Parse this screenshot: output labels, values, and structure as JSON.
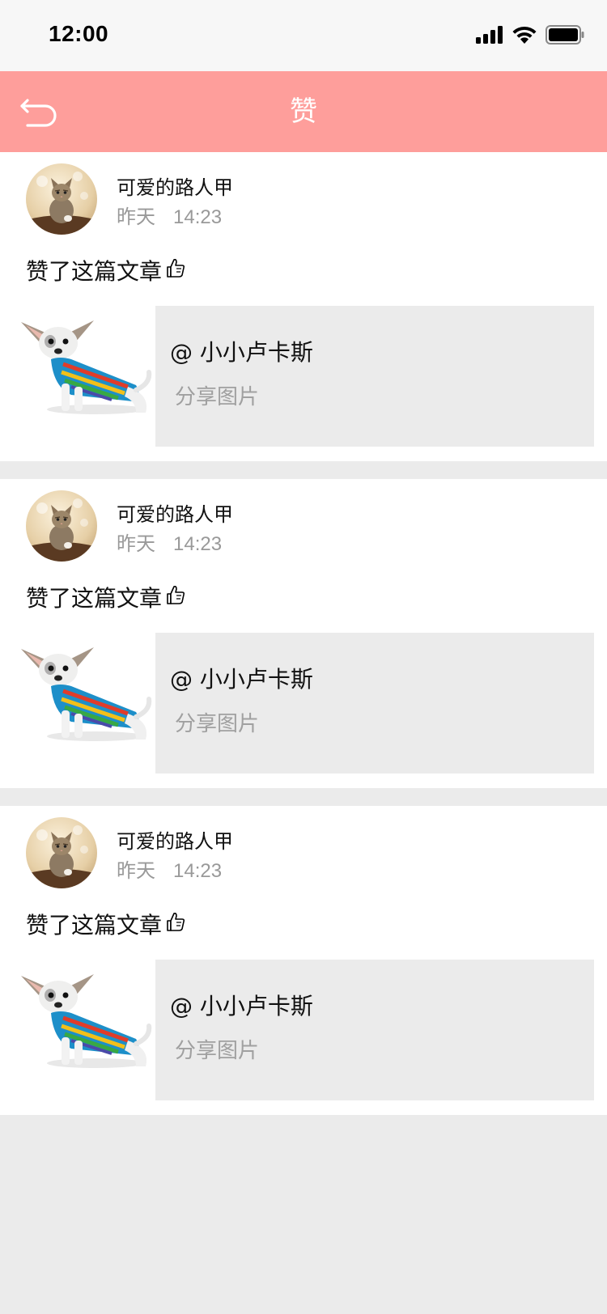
{
  "status_bar": {
    "time": "12:00",
    "icons": [
      "signal-icon",
      "wifi-icon",
      "battery-icon"
    ]
  },
  "nav": {
    "title": "赞",
    "back_icon": "back-arrow-icon",
    "bg_color": "#fe9e9b"
  },
  "notifications": [
    {
      "user_name": "可爱的路人甲",
      "date": "昨天",
      "time": "14:23",
      "action": "赞了这篇文章",
      "action_icon": "thumbs-up-icon",
      "author": "@ 小小卢卡斯",
      "share_type": "分享图片"
    },
    {
      "user_name": "可爱的路人甲",
      "date": "昨天",
      "time": "14:23",
      "action": "赞了这篇文章",
      "action_icon": "thumbs-up-icon",
      "author": "@ 小小卢卡斯",
      "share_type": "分享图片"
    },
    {
      "user_name": "可爱的路人甲",
      "date": "昨天",
      "time": "14:23",
      "action": "赞了这篇文章",
      "action_icon": "thumbs-up-icon",
      "author": "@ 小小卢卡斯",
      "share_type": "分享图片"
    }
  ],
  "colors": {
    "page_bg": "#ebebeb",
    "card_bg": "#ffffff",
    "share_box_bg": "#ebebeb",
    "secondary_text": "#999999"
  }
}
